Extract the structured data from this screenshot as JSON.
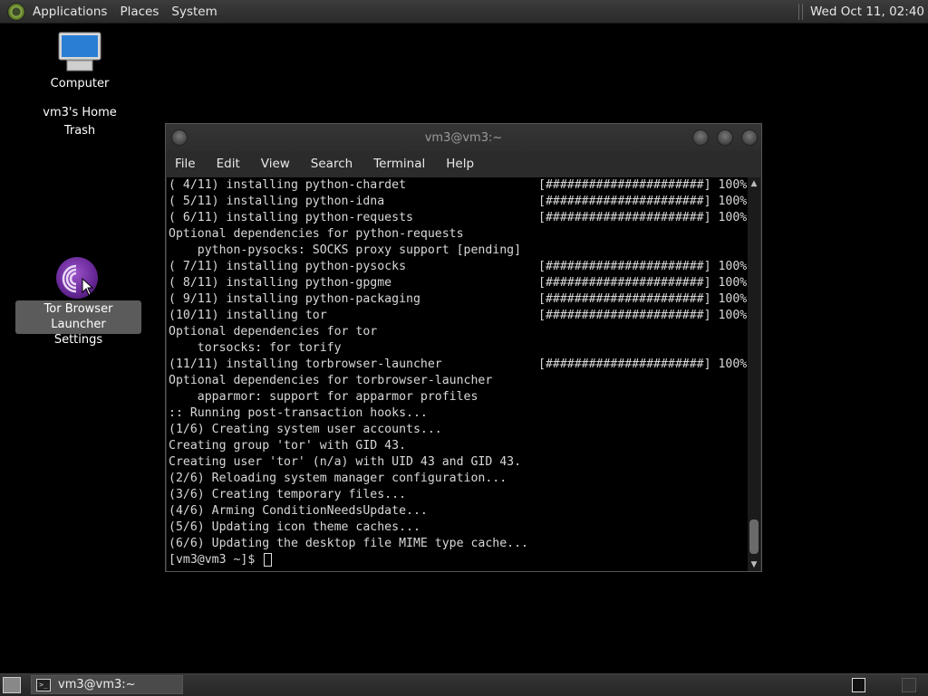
{
  "top_panel": {
    "menus": [
      "Applications",
      "Places",
      "System"
    ],
    "clock": "Wed Oct 11, 02:40"
  },
  "desktop": {
    "computer_label": "Computer",
    "home_label": "vm3's Home",
    "trash_label": "Trash",
    "tor_label_line1": "Tor Browser Launcher",
    "tor_label_line2": "Settings"
  },
  "terminal": {
    "title": "vm3@vm3:~",
    "menus": [
      "File",
      "Edit",
      "View",
      "Search",
      "Terminal",
      "Help"
    ],
    "lines": [
      {
        "text": "( 4/11) installing python-chardet",
        "right": "[######################] 100%"
      },
      {
        "text": "( 5/11) installing python-idna",
        "right": "[######################] 100%"
      },
      {
        "text": "( 6/11) installing python-requests",
        "right": "[######################] 100%"
      },
      {
        "text": "Optional dependencies for python-requests",
        "right": ""
      },
      {
        "text": "    python-pysocks: SOCKS proxy support [pending]",
        "right": ""
      },
      {
        "text": "( 7/11) installing python-pysocks",
        "right": "[######################] 100%"
      },
      {
        "text": "( 8/11) installing python-gpgme",
        "right": "[######################] 100%"
      },
      {
        "text": "( 9/11) installing python-packaging",
        "right": "[######################] 100%"
      },
      {
        "text": "(10/11) installing tor",
        "right": "[######################] 100%"
      },
      {
        "text": "Optional dependencies for tor",
        "right": ""
      },
      {
        "text": "    torsocks: for torify",
        "right": ""
      },
      {
        "text": "(11/11) installing torbrowser-launcher",
        "right": "[######################] 100%"
      },
      {
        "text": "Optional dependencies for torbrowser-launcher",
        "right": ""
      },
      {
        "text": "    apparmor: support for apparmor profiles",
        "right": ""
      },
      {
        "text": ":: Running post-transaction hooks...",
        "right": ""
      },
      {
        "text": "(1/6) Creating system user accounts...",
        "right": ""
      },
      {
        "text": "Creating group 'tor' with GID 43.",
        "right": ""
      },
      {
        "text": "Creating user 'tor' (n/a) with UID 43 and GID 43.",
        "right": ""
      },
      {
        "text": "(2/6) Reloading system manager configuration...",
        "right": ""
      },
      {
        "text": "(3/6) Creating temporary files...",
        "right": ""
      },
      {
        "text": "(4/6) Arming ConditionNeedsUpdate...",
        "right": ""
      },
      {
        "text": "(5/6) Updating icon theme caches...",
        "right": ""
      },
      {
        "text": "(6/6) Updating the desktop file MIME type cache...",
        "right": ""
      }
    ],
    "prompt": "[vm3@vm3 ~]$ "
  },
  "taskbar": {
    "task_label": "vm3@vm3:~"
  }
}
